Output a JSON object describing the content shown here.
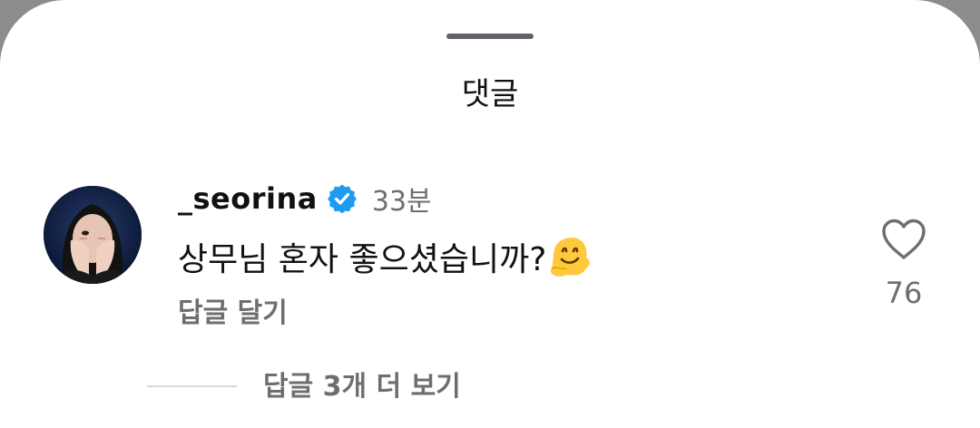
{
  "sheet": {
    "title": "댓글"
  },
  "comment": {
    "username": "_seorina",
    "verified_icon": "verified-badge-icon",
    "timestamp": "33분",
    "text": "상무님 혼자 좋으셨습니까?",
    "emoji": "melting-face-emoji",
    "reply_label": "답글 달기",
    "like_icon": "heart-outline-icon",
    "like_count": "76",
    "view_replies_label": "답글 3개 더 보기"
  },
  "colors": {
    "verified_blue": "#1d9bf0",
    "muted_text": "#6e6e6e",
    "primary_text": "#111111",
    "handle": "#5f6368"
  }
}
